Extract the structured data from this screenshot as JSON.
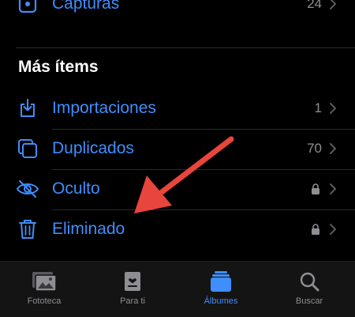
{
  "top_row": {
    "label": "Capturas",
    "count": "24",
    "icon": "screenshot-icon"
  },
  "section": {
    "title": "Más ítems"
  },
  "items": [
    {
      "label": "Importaciones",
      "count": "1",
      "icon": "import-icon",
      "locked": false
    },
    {
      "label": "Duplicados",
      "count": "70",
      "icon": "duplicates-icon",
      "locked": false
    },
    {
      "label": "Oculto",
      "count": "",
      "icon": "eye-slash-icon",
      "locked": true
    },
    {
      "label": "Eliminado",
      "count": "",
      "icon": "trash-icon",
      "locked": true
    }
  ],
  "tabbar": {
    "tabs": [
      {
        "label": "Fototeca",
        "icon": "photos-library-icon",
        "active": false
      },
      {
        "label": "Para ti",
        "icon": "for-you-icon",
        "active": false
      },
      {
        "label": "Álbumes",
        "icon": "albums-icon",
        "active": true
      },
      {
        "label": "Buscar",
        "icon": "search-icon",
        "active": false
      }
    ]
  },
  "colors": {
    "accent": "#3f8efc",
    "background": "#000000",
    "secondary_text": "#8e8e93",
    "annotation_arrow": "#e8453c"
  }
}
